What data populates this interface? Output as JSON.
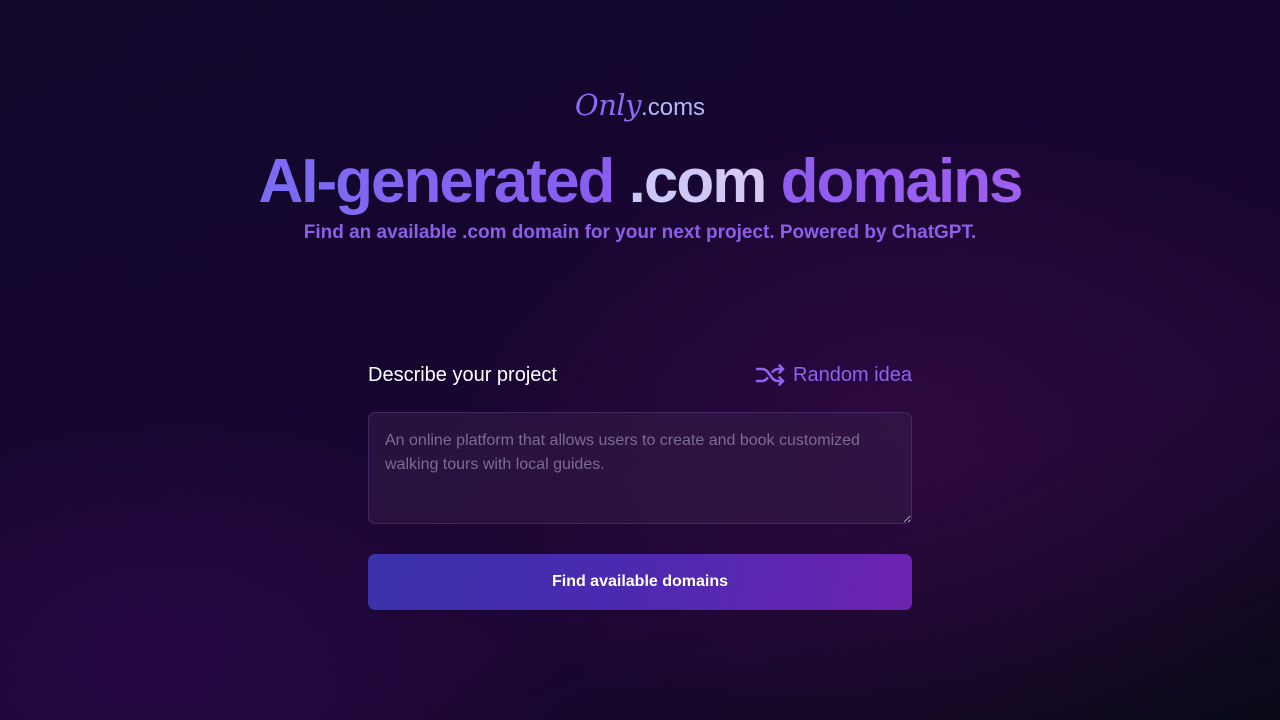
{
  "logo": {
    "script": "Only",
    "suffix": ".coms"
  },
  "hero": {
    "headline_part1": "AI-generated",
    "headline_part2": ".com",
    "headline_part3": "domains",
    "subtitle": "Find an available .com domain for your next project. Powered by ChatGPT."
  },
  "form": {
    "label": "Describe your project",
    "random_idea": {
      "label": "Random idea",
      "icon": "shuffle-icon"
    },
    "textarea": {
      "value": "",
      "placeholder": "An online platform that allows users to create and book customized walking tours with local guides."
    },
    "submit_label": "Find available domains"
  },
  "colors": {
    "accent": "#8f62f0",
    "button_start": "#3a33a8",
    "button_end": "#6d23b0",
    "background": "#14062f"
  }
}
